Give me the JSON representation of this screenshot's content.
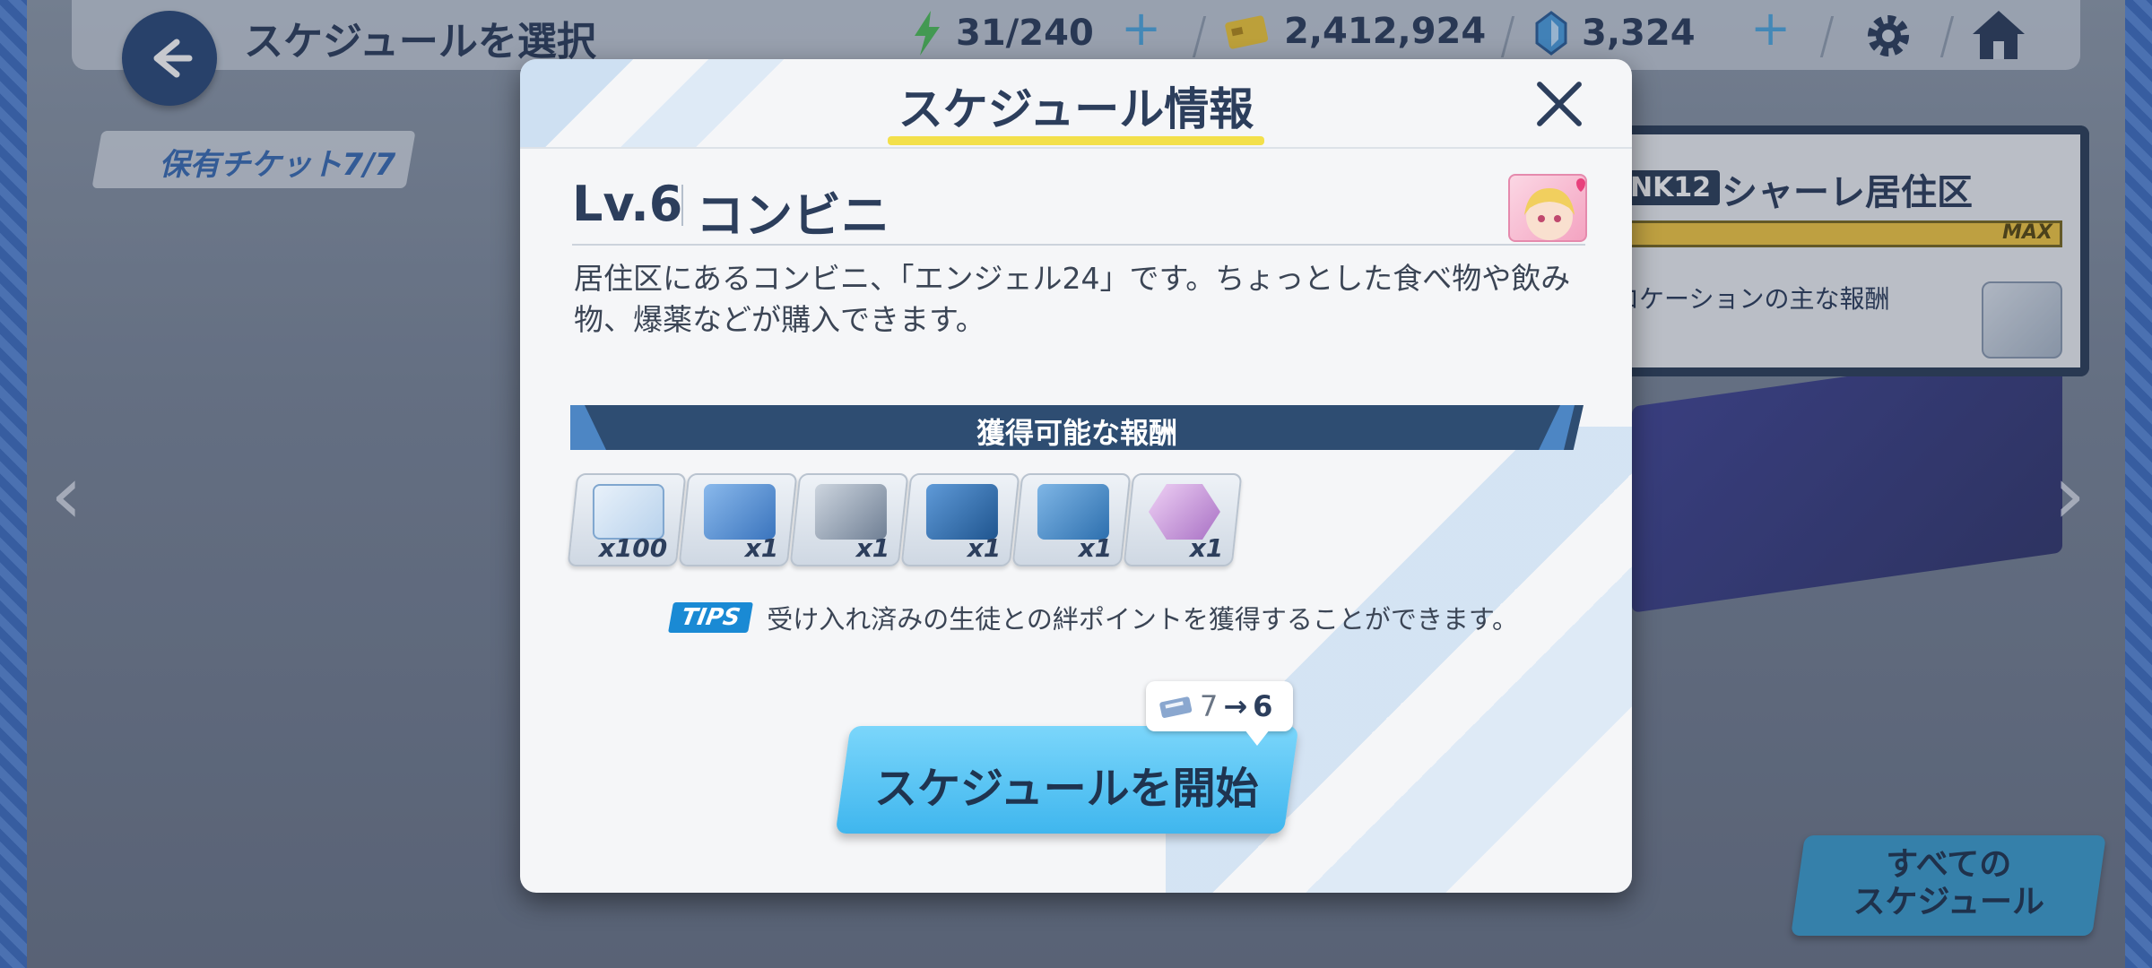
{
  "header": {
    "title": "スケジュールを選択",
    "ap": "31/240",
    "credits": "2,412,924",
    "gems": "3,324"
  },
  "ticket": {
    "label": "保有チケット7/7"
  },
  "side_panel": {
    "rank": "NK12",
    "area": "シャーレ居住区",
    "max_label": "MAX",
    "rewards_label": "ロケーションの主な報酬"
  },
  "all_schedules_button": "すべての\nスケジュール",
  "modal": {
    "title": "スケジュール情報",
    "level": "Lv.6",
    "location": "コンビニ",
    "description": "居住区にあるコンビニ、「エンジェル24」です。ちょっとした食べ物や飲み物、爆薬などが購入できます。",
    "rewards_header": "獲得可能な報酬",
    "rewards": [
      {
        "icon": "exp-report-icon",
        "count": "x100",
        "color": "#cfe3f5"
      },
      {
        "icon": "mystery-gift-box-icon",
        "count": "x1",
        "color": "#5a8fd0"
      },
      {
        "icon": "mystery-gift-box-gray-icon",
        "count": "x1",
        "color": "#8997aa"
      },
      {
        "icon": "ex-gift-box-icon",
        "count": "x1",
        "color": "#2e6fb8"
      },
      {
        "icon": "gift-box-stack-icon",
        "count": "x1",
        "color": "#3d87c9"
      },
      {
        "icon": "student-portrait-icon",
        "count": "x1",
        "color": "#d7a6e6"
      }
    ],
    "tips_label": "TIPS",
    "tips_text": "受け入れ済みの生徒との絆ポイントを獲得することができます。",
    "start_button": "スケジュールを開始",
    "ticket_cost_before": "7",
    "ticket_cost_arrow": "→",
    "ticket_cost_after": "6"
  }
}
